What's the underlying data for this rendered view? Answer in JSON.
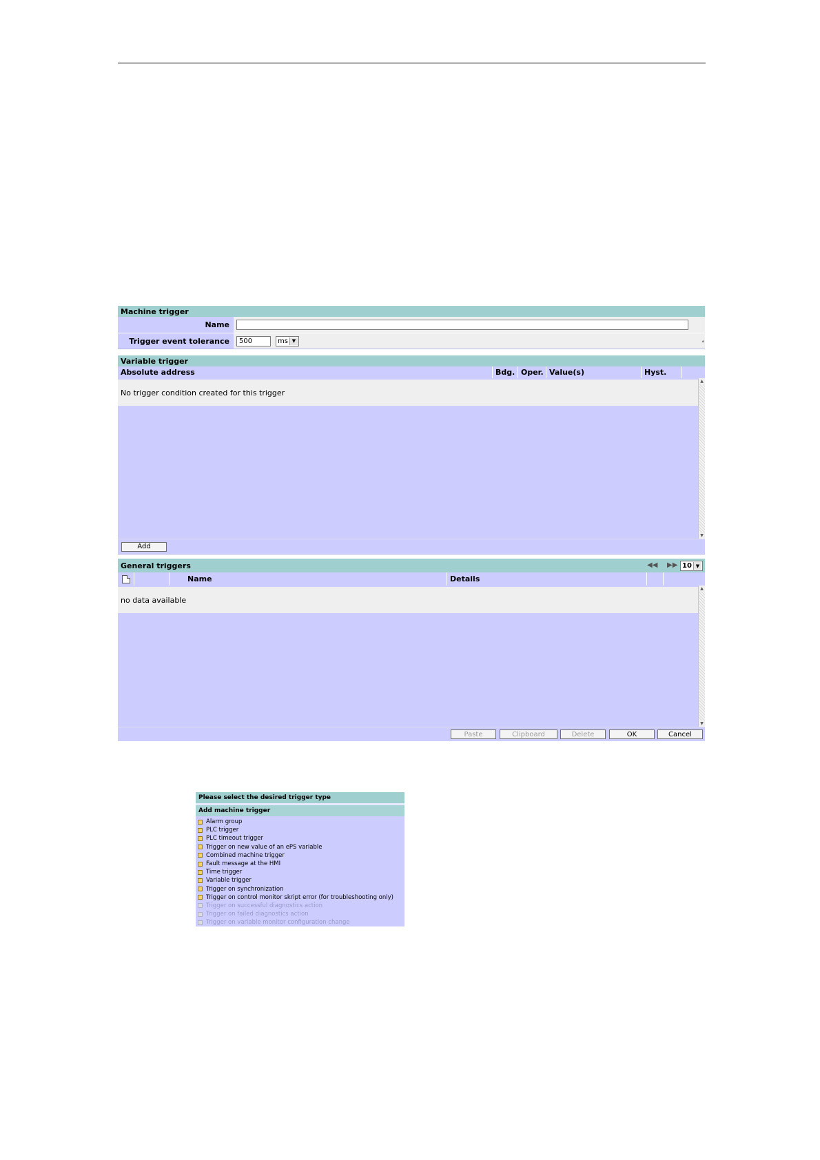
{
  "machine_trigger": {
    "title": "Machine trigger",
    "name_label": "Name",
    "name_value": "",
    "tolerance_label": "Trigger event tolerance",
    "tolerance_value": "500",
    "tolerance_unit": "ms"
  },
  "variable_trigger": {
    "title": "Variable trigger",
    "columns": [
      "Absolute address",
      "Bdg.",
      "Oper.",
      "Value(s)",
      "Hyst."
    ],
    "empty_message": "No trigger condition created for this trigger",
    "add_label": "Add"
  },
  "general_triggers": {
    "title": "General triggers",
    "page_size": "10",
    "columns": [
      "Name",
      "Details"
    ],
    "empty_message": "no data available"
  },
  "footer_buttons": {
    "paste": "Paste",
    "clipboard": "Clipboard",
    "delete": "Delete",
    "ok": "OK",
    "cancel": "Cancel"
  },
  "trigger_type_dialog": {
    "title": "Please select the desired trigger type",
    "section": "Add machine trigger",
    "items": [
      {
        "label": "Alarm group",
        "enabled": true
      },
      {
        "label": "PLC trigger",
        "enabled": true
      },
      {
        "label": "PLC timeout trigger",
        "enabled": true
      },
      {
        "label": "Trigger on new value of an ePS variable",
        "enabled": true
      },
      {
        "label": "Combined machine trigger",
        "enabled": true
      },
      {
        "label": "Fault message at the HMI",
        "enabled": true
      },
      {
        "label": "Time trigger",
        "enabled": true
      },
      {
        "label": "Variable trigger",
        "enabled": true
      },
      {
        "label": "Trigger on synchronization",
        "enabled": true
      },
      {
        "label": "Trigger on control monitor skript error (for troubleshooting only)",
        "enabled": true
      },
      {
        "label": "Trigger on successful diagnostics action",
        "enabled": false
      },
      {
        "label": "Trigger on failed diagnostics action",
        "enabled": false
      },
      {
        "label": "Trigger on variable monitor configuration change",
        "enabled": false
      }
    ]
  },
  "colors": {
    "header_teal": "#9fd0cf",
    "panel_lavender": "#ccccff",
    "row_light": "#efefef"
  }
}
